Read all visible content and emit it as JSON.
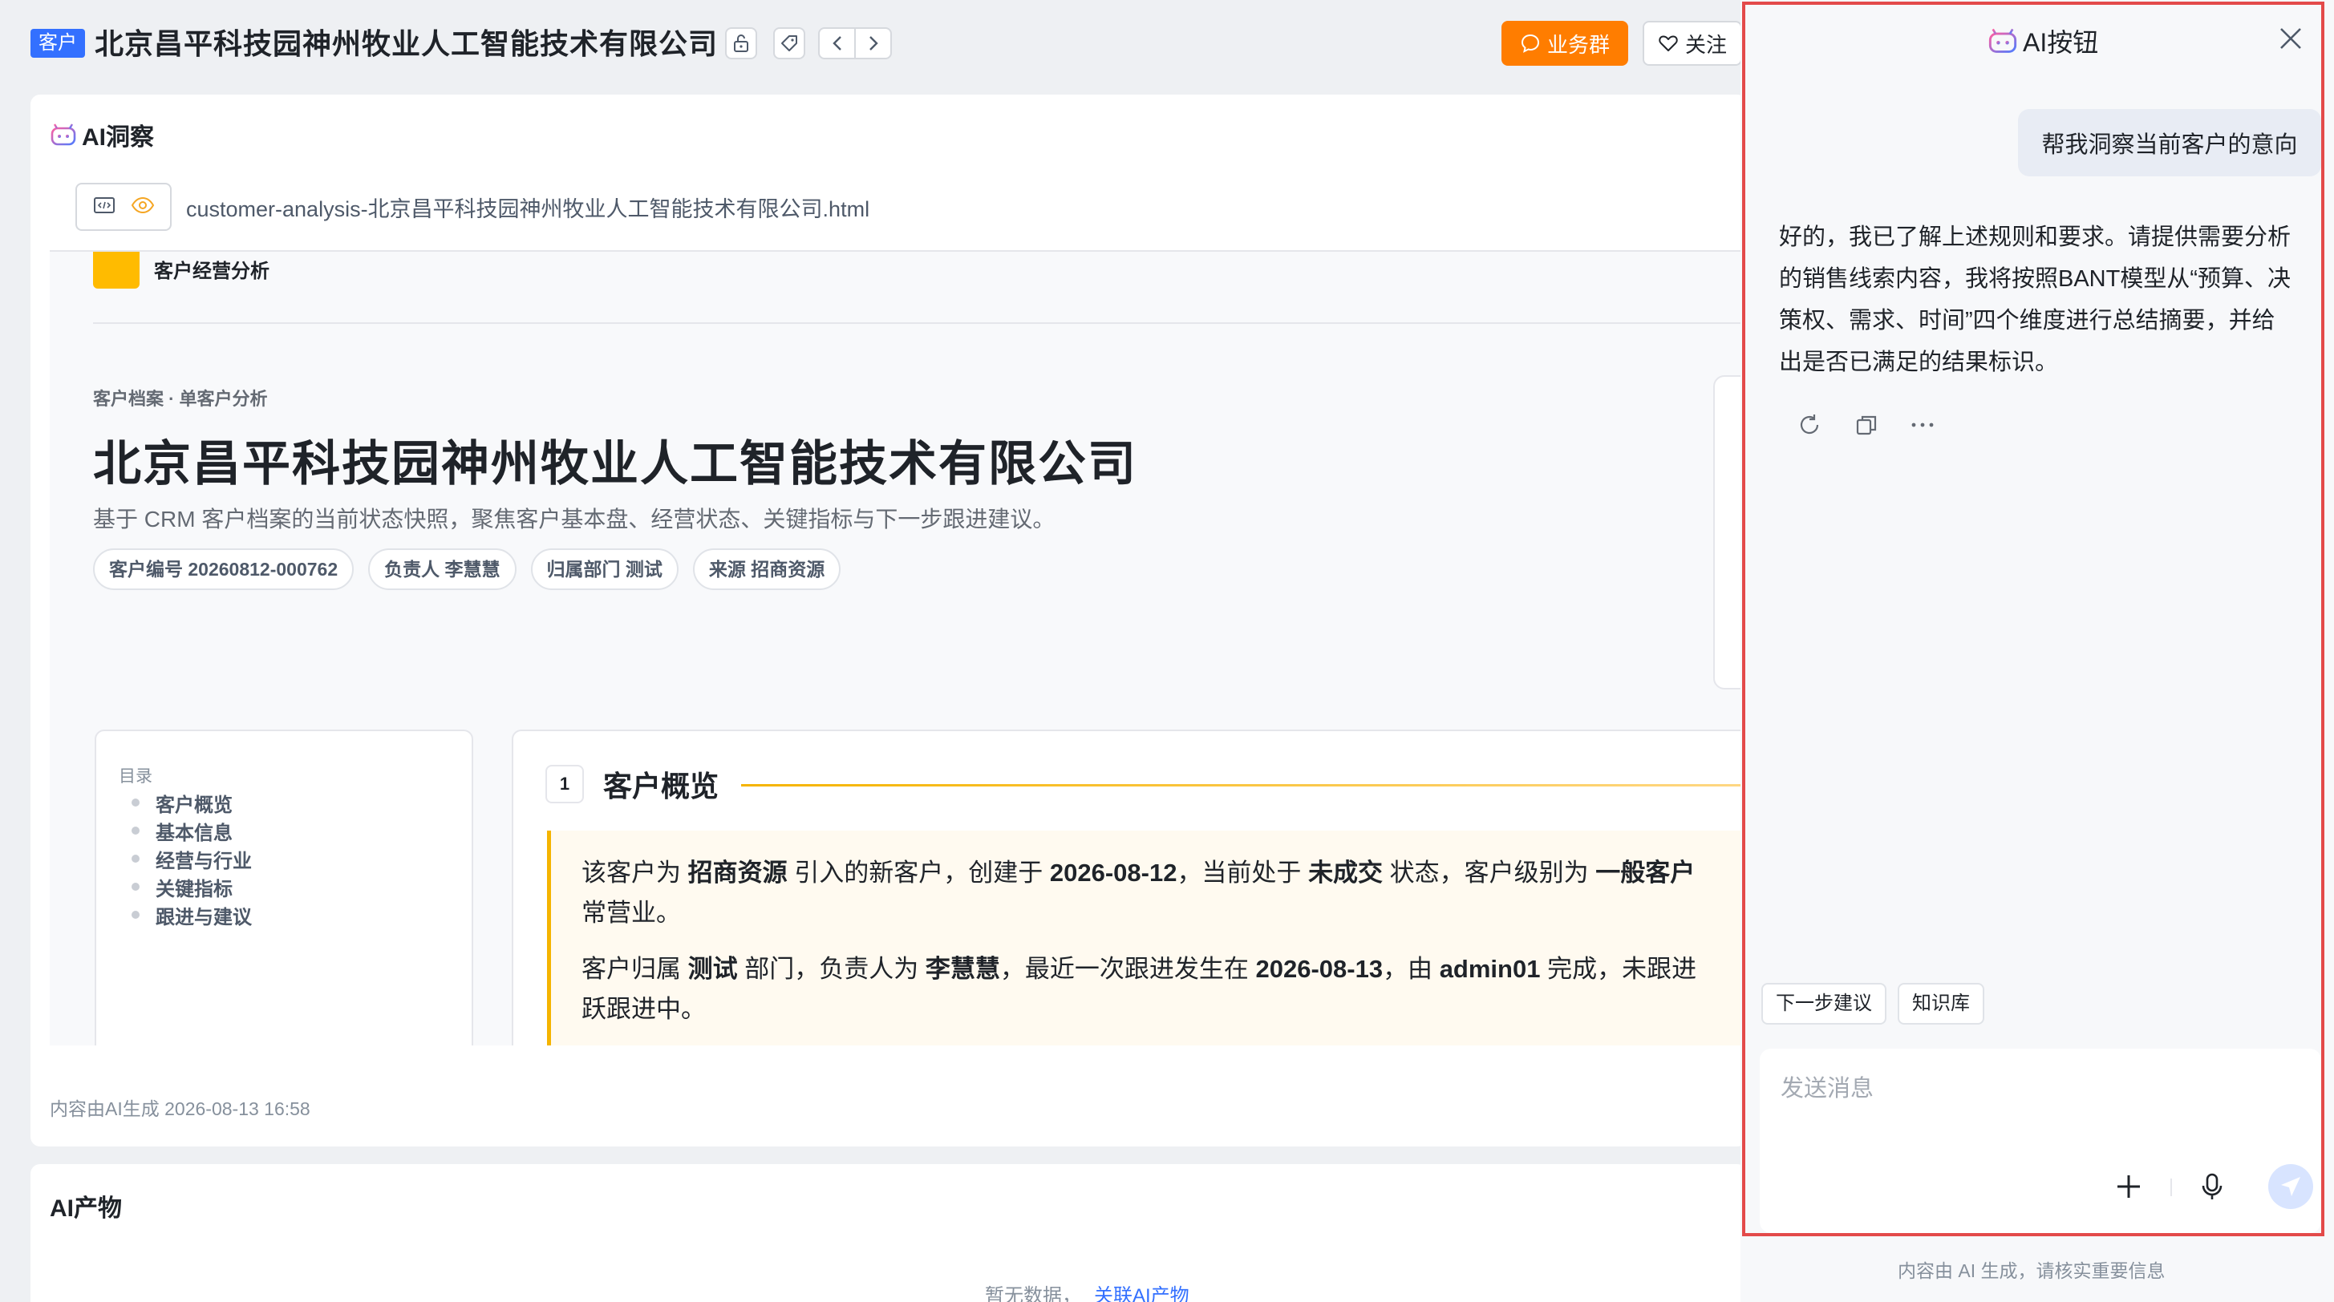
{
  "header": {
    "tag": "客户",
    "title": "北京昌平科技园神州牧业人工智能技术有限公司",
    "biz_group_label": "业务群",
    "follow_label": "关注"
  },
  "insight": {
    "title": "AI洞察",
    "file_name": "customer-analysis-北京昌平科技园神州牧业人工智能技术有限公司.html",
    "generated_note": "内容由AI生成 2026-08-13 16:58"
  },
  "preview": {
    "brand": "客户经营分析",
    "kicker": "客户档案 · 单客户分析",
    "heading": "北京昌平科技园神州牧业人工智能技术有限公司",
    "description": "基于 CRM 客户档案的当前状态快照，聚焦客户基本盘、经营状态、关键指标与下一步跟进建议。",
    "chips": [
      "客户编号 20260812-000762",
      "负责人 李慧慧",
      "归属部门 测试",
      "来源 招商资源"
    ],
    "toc": {
      "title": "目录",
      "items": [
        "客户概览",
        "基本信息",
        "经营与行业",
        "关键指标",
        "跟进与建议"
      ]
    },
    "section": {
      "number": "1",
      "title": "客户概览",
      "p1": {
        "a": "该客户为 ",
        "b1": "招商资源",
        "c": " 引入的新客户，创建于 ",
        "b2": "2026-08-12",
        "d": "，当前处于 ",
        "b3": "未成交",
        "e": " 状态，客户级别为 ",
        "b4": "一般客户",
        "f": "常营业。"
      },
      "p2": {
        "a": "客户归属 ",
        "b1": "测试",
        "c": " 部门，负责人为 ",
        "b2": "李慧慧",
        "d": "，最近一次跟进发生在 ",
        "b3": "2026-08-13",
        "e": "，由 ",
        "b4": "admin01",
        "f": " 完成，未跟进",
        "g": "跃跟进中。"
      }
    }
  },
  "output": {
    "title": "AI产物",
    "empty_text": "暂无数据，",
    "empty_link": "关联AI产物"
  },
  "ai_panel": {
    "title": "AI按钮",
    "user_message": "帮我洞察当前客户的意向",
    "bot_message": "好的，我已了解上述规则和要求。请提供需要分析的销售线索内容，我将按照BANT模型从“预算、决策权、需求、时间”四个维度进行总结摘要，并给出是否已满足的结果标识。",
    "quick_actions": [
      "下一步建议",
      "知识库"
    ],
    "input_placeholder": "发送消息",
    "footer": "内容由 AI 生成，请核实重要信息"
  },
  "colors": {
    "accent_blue": "#3370ff",
    "accent_orange": "#ff7d00",
    "highlight_yellow": "#f5b400",
    "panel_outline_red": "#e34a4a"
  },
  "icons": [
    "lock-icon",
    "tag-icon",
    "chevron-left-icon",
    "chevron-right-icon",
    "chat-bubble-icon",
    "heart-icon",
    "ai-robot-icon",
    "code-icon",
    "eye-icon",
    "close-icon",
    "refresh-icon",
    "copy-icon",
    "more-icon",
    "plus-icon",
    "mic-icon",
    "send-icon"
  ]
}
